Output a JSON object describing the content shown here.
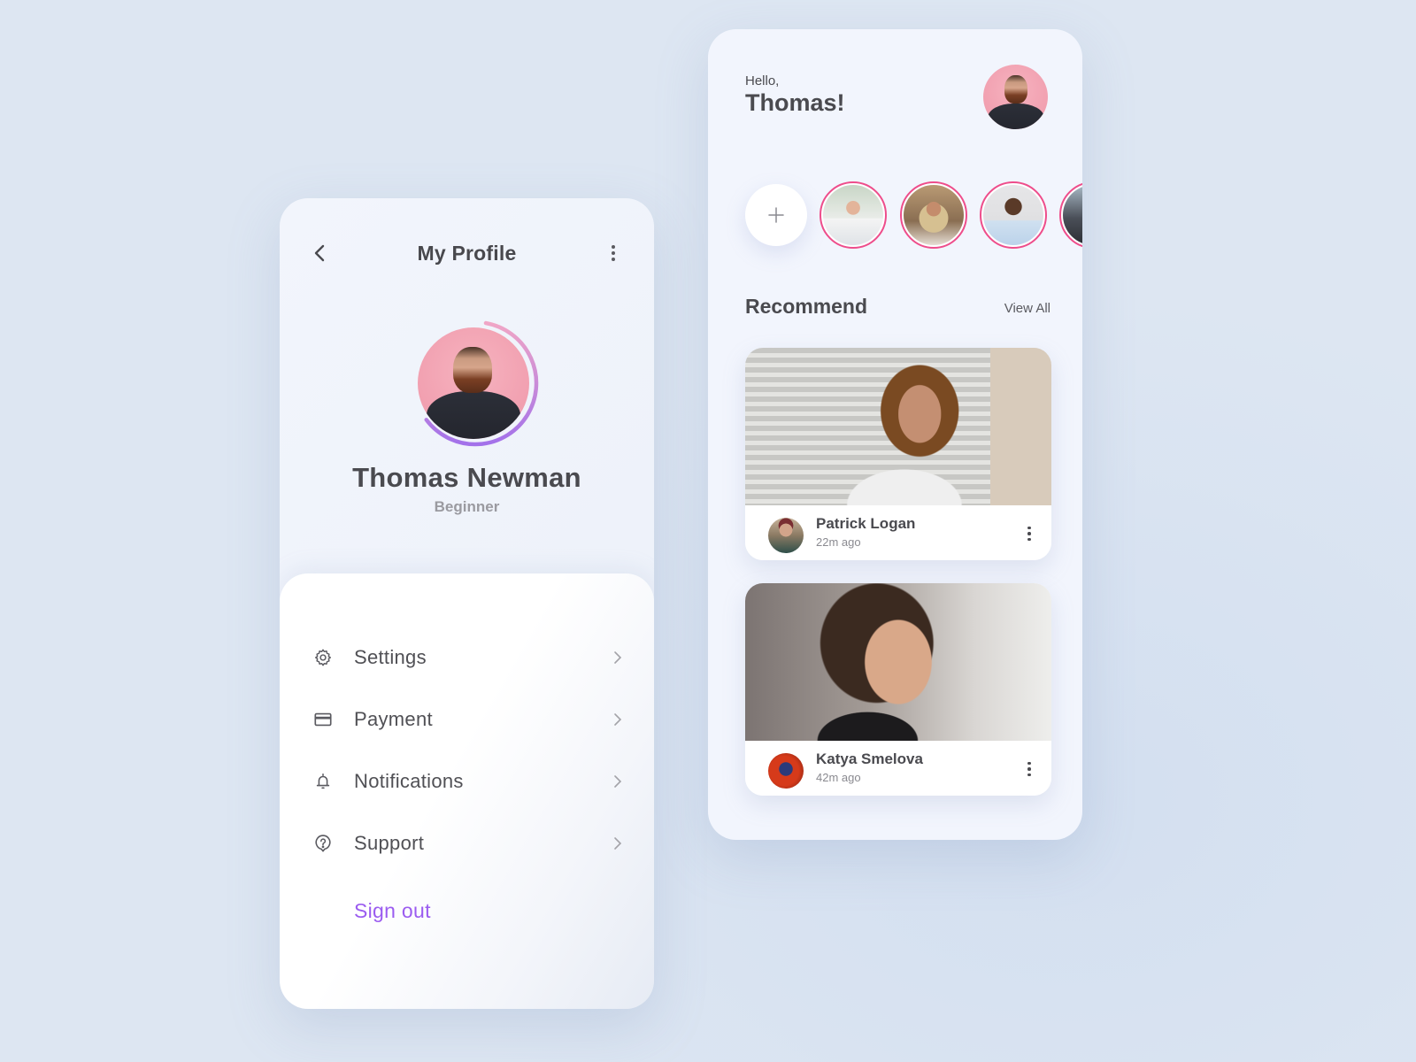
{
  "profile_screen": {
    "title": "My Profile",
    "back_icon": "chevron-left-icon",
    "more_icon": "more-vertical-icon",
    "user": {
      "name": "Thomas Newman",
      "level": "Beginner",
      "avatar": "avatar-thomas",
      "progress_ring": 0.62
    },
    "menu": [
      {
        "label": "Settings",
        "icon": "gear-icon"
      },
      {
        "label": "Payment",
        "icon": "credit-card-icon"
      },
      {
        "label": "Notifications",
        "icon": "bell-icon"
      },
      {
        "label": "Support",
        "icon": "help-circle-icon"
      }
    ],
    "sign_out": "Sign out"
  },
  "home_screen": {
    "greeting": "Hello,",
    "user_name": "Thomas!",
    "add_story_icon": "plus-icon",
    "stories": [
      {
        "avatar": "story-avatar-1"
      },
      {
        "avatar": "story-avatar-2"
      },
      {
        "avatar": "story-avatar-3"
      },
      {
        "avatar": "story-avatar-4"
      }
    ],
    "recommend": {
      "title": "Recommend",
      "view_all": "View All",
      "posts": [
        {
          "author": "Patrick Logan",
          "time": "22m ago"
        },
        {
          "author": "Katya Smelova",
          "time": "42m ago"
        }
      ]
    }
  },
  "colors": {
    "background": "#dde6f2",
    "card": "#f2f5fd",
    "text": "#4a4a4f",
    "accent_purple": "#9b5cf0",
    "story_ring": "#ee4d8b",
    "progress_start": "#f0a6c6",
    "progress_end": "#a371ea"
  }
}
